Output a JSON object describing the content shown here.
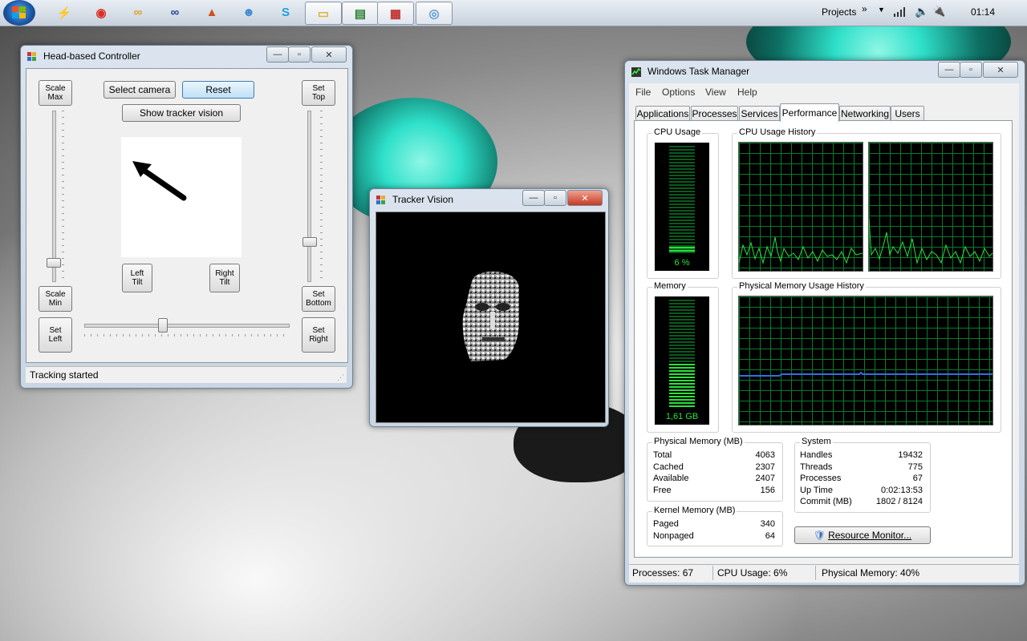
{
  "taskbar": {
    "apps": [
      {
        "icon": "lightning-icon",
        "color": "#c8962c"
      },
      {
        "icon": "chrome-icon",
        "color": "#d93025"
      },
      {
        "icon": "rings-icon",
        "color": "#e0a020"
      },
      {
        "icon": "infinity-icon",
        "color": "#2040a0"
      },
      {
        "icon": "matlab-icon",
        "color": "#d05020"
      },
      {
        "icon": "people-icon",
        "color": "#3a8ad0"
      },
      {
        "icon": "skype-icon",
        "color": "#1fa0e0"
      },
      {
        "icon": "folder-icon",
        "color": "#e0b040"
      },
      {
        "icon": "task-manager-icon",
        "color": "#2e7d32"
      },
      {
        "icon": "app-window-icon",
        "color": "#c03030"
      },
      {
        "icon": "paint-icon",
        "color": "#5a9ad0"
      }
    ],
    "toolbar_label": "Projects",
    "toolbar_chevron": "»",
    "clock": "01:14"
  },
  "head_controller": {
    "title": "Head-based Controller",
    "scale_max": "Scale\nMax",
    "scale_min": "Scale\nMin",
    "select_camera": "Select camera",
    "reset": "Reset",
    "show_tracker_vision": "Show tracker vision",
    "set_top": "Set\nTop",
    "set_bottom": "Set\nBottom",
    "set_left": "Set\nLeft",
    "set_right": "Set\nRight",
    "left_tilt": "Left\nTilt",
    "right_tilt": "Right\nTilt",
    "status": "Tracking started"
  },
  "tracker_vision": {
    "title": "Tracker Vision"
  },
  "task_manager": {
    "title": "Windows Task Manager",
    "menu": [
      "File",
      "Options",
      "View",
      "Help"
    ],
    "tabs": [
      "Applications",
      "Processes",
      "Services",
      "Performance",
      "Networking",
      "Users"
    ],
    "selected_tab": "Performance",
    "cpu_usage_label": "CPU Usage",
    "cpu_usage_value": "6 %",
    "cpu_fraction": 0.06,
    "cpu_history_label": "CPU Usage History",
    "memory_label": "Memory",
    "memory_value": "1,61 GB",
    "memory_fraction": 0.4,
    "phys_history_label": "Physical Memory Usage History",
    "physical_memory": {
      "title": "Physical Memory (MB)",
      "rows": [
        {
          "k": "Total",
          "v": "4063"
        },
        {
          "k": "Cached",
          "v": "2307"
        },
        {
          "k": "Available",
          "v": "2407"
        },
        {
          "k": "Free",
          "v": "156"
        }
      ]
    },
    "kernel_memory": {
      "title": "Kernel Memory (MB)",
      "rows": [
        {
          "k": "Paged",
          "v": "340"
        },
        {
          "k": "Nonpaged",
          "v": "64"
        }
      ]
    },
    "system": {
      "title": "System",
      "rows": [
        {
          "k": "Handles",
          "v": "19432"
        },
        {
          "k": "Threads",
          "v": "775"
        },
        {
          "k": "Processes",
          "v": "67"
        },
        {
          "k": "Up Time",
          "v": "0:02:13:53"
        },
        {
          "k": "Commit (MB)",
          "v": "1802 / 8124"
        }
      ]
    },
    "resource_monitor": "Resource Monitor...",
    "status": {
      "processes": "Processes: 67",
      "cpu": "CPU Usage: 6%",
      "memory": "Physical Memory: 40%"
    }
  },
  "colors": {
    "graph_green": "#27e33a",
    "grid_green": "#0a7a2e",
    "memory_line": "#2f6fe0",
    "cat_eye": "#2ee0c9"
  }
}
